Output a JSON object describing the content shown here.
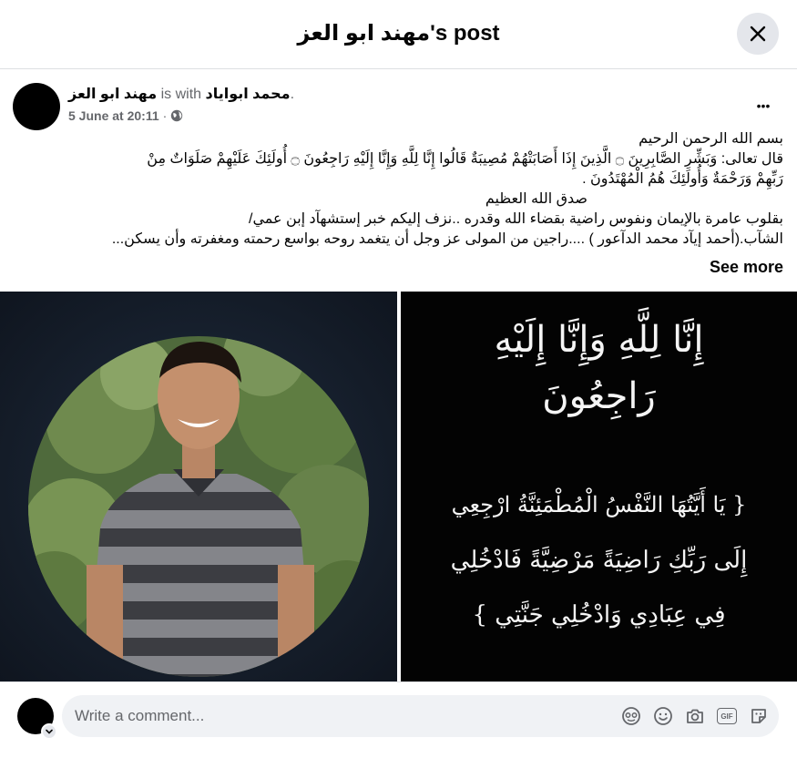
{
  "header": {
    "title": "مهند ابو العز's post"
  },
  "post": {
    "author": "مهند ابو العز",
    "with_text": "is with",
    "tagged": "محمد ابواياد",
    "tagged_suffix": ".",
    "date": "5 June at 20:11",
    "date_sep": "·",
    "more_glyph": "•••",
    "lines": [
      "بسم الله الرحمن الرحيم",
      "قال تعالى: وَبَشِّرِ الصَّابِرِينَ ۝ الَّذِينَ إِذَا أَصَابَتْهُمْ مُصِيبَةٌ قَالُوا إِنَّا لِلَّهِ وَإِنَّا إِلَيْهِ رَاجِعُونَ ۝ أُولَئِكَ عَلَيْهِمْ صَلَوَاتٌ مِنْ",
      "رَبِّهِمْ وَرَحْمَةٌ وَأُولَئِكَ هُمُ الْمُهْتَدُونَ .",
      "صدق الله العظيم",
      "بقلوب عامرة بالإيمان ونفوس راضية بقضاء الله وقدره ..نزف إليكم خبر إستشهآد إبن عمي/",
      "الشآب.(أحمد إيآد محمد الدآعور ) ....راجين من المولى عز وجل أن يتغمد روحه بواسع رحمته ومغفرته وأن يسكن..."
    ],
    "see_more": "See more"
  },
  "image_right": {
    "lines": [
      "إِنَّا لِلَّهِ وَإِنَّا إِلَيْهِ",
      "رَاجِعُونَ",
      "{ يَا أَيَّتُهَا النَّفْسُ الْمُطْمَئِنَّةُ ارْجِعِي",
      "إِلَى رَبِّكِ رَاضِيَةً مَرْضِيَّةً فَادْخُلِي",
      "فِي عِبَادِي وَادْخُلِي جَنَّتِي }"
    ]
  },
  "composer": {
    "placeholder": "Write a comment...",
    "gif_label": "GIF"
  },
  "icons": {
    "close": "close-icon",
    "globe": "globe-icon",
    "more": "more-options-icon",
    "avatar_sticker": "avatar-sticker-icon",
    "emoji": "emoji-icon",
    "camera": "camera-icon",
    "gif": "gif-icon",
    "sticker": "sticker-icon"
  },
  "colors": {
    "text_primary": "#050505",
    "text_secondary": "#65676b",
    "button_bg": "#e4e6eb",
    "input_bg": "#f0f2f5"
  }
}
